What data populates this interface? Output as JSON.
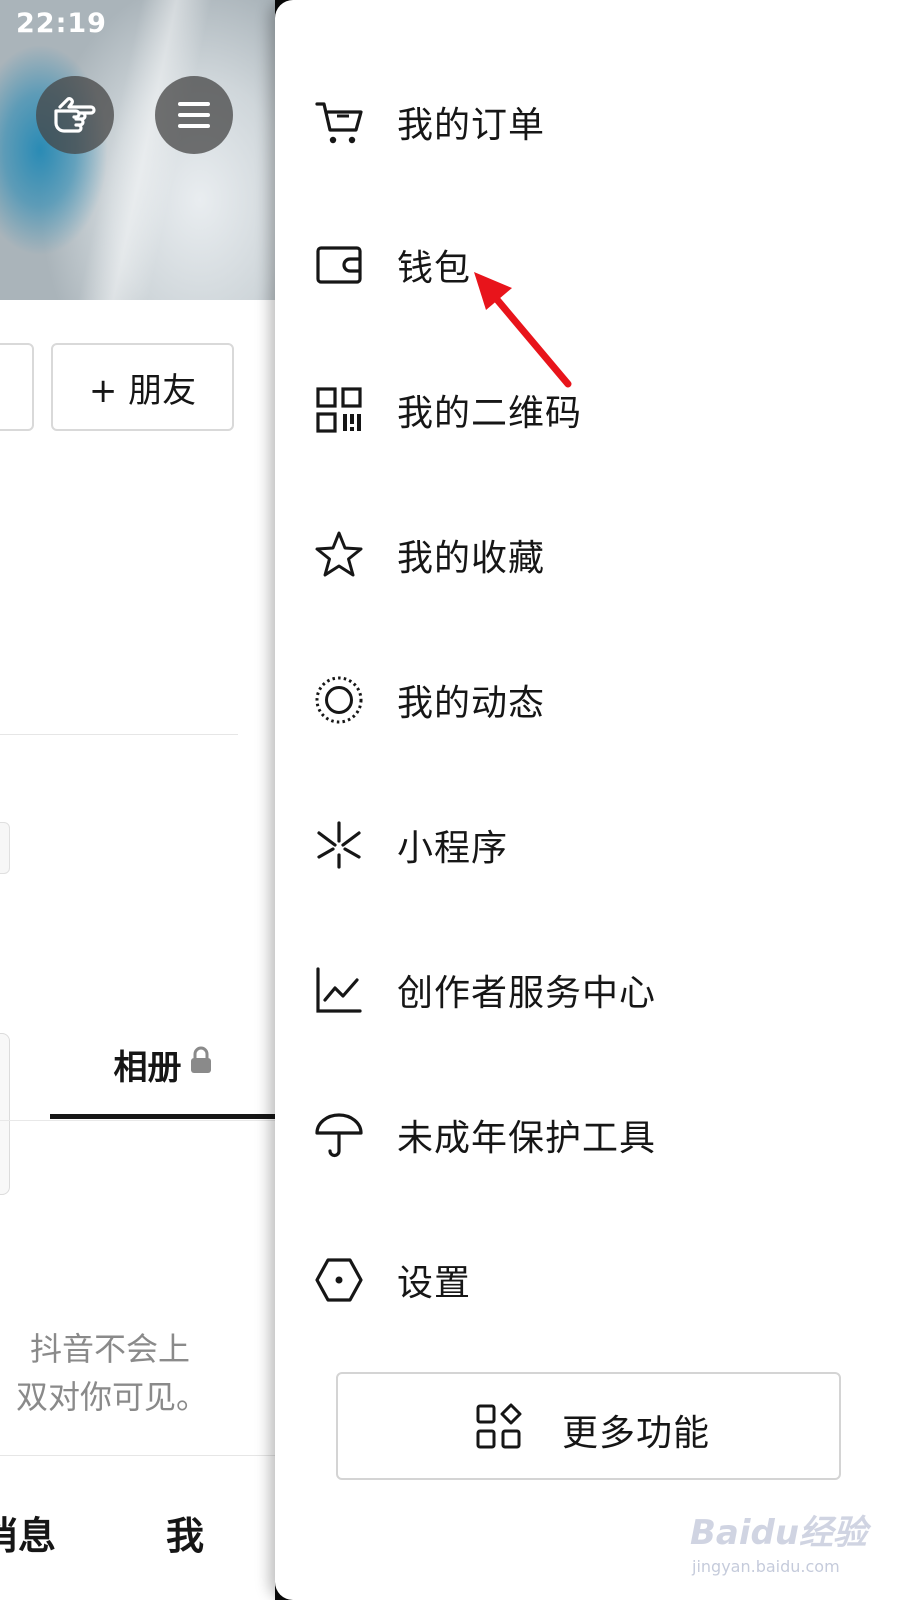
{
  "status_bar": {
    "time": "22:19"
  },
  "profile": {
    "add_friend_label": "+ 朋友",
    "tab_album_label": "相册",
    "privacy_line1": "抖音不会上",
    "privacy_line2": "双对你可见。",
    "bottom_nav": {
      "messages_partial": "消息",
      "me": "我"
    }
  },
  "drawer": {
    "items": [
      {
        "label": "我的订单",
        "icon": "cart-icon"
      },
      {
        "label": "钱包",
        "icon": "wallet-icon"
      },
      {
        "label": "我的二维码",
        "icon": "qr-code-icon"
      },
      {
        "label": "我的收藏",
        "icon": "star-icon"
      },
      {
        "label": "我的动态",
        "icon": "moments-icon"
      },
      {
        "label": "小程序",
        "icon": "mini-program-icon"
      },
      {
        "label": "创作者服务中心",
        "icon": "chart-icon"
      },
      {
        "label": "未成年保护工具",
        "icon": "umbrella-icon"
      },
      {
        "label": "设置",
        "icon": "settings-hexagon-icon"
      }
    ],
    "more_button_label": "更多功能"
  },
  "annotation": {
    "color": "#e8141b",
    "target": "钱包"
  },
  "watermark": {
    "brand": "Baidu经验",
    "url": "jingyan.baidu.com"
  }
}
